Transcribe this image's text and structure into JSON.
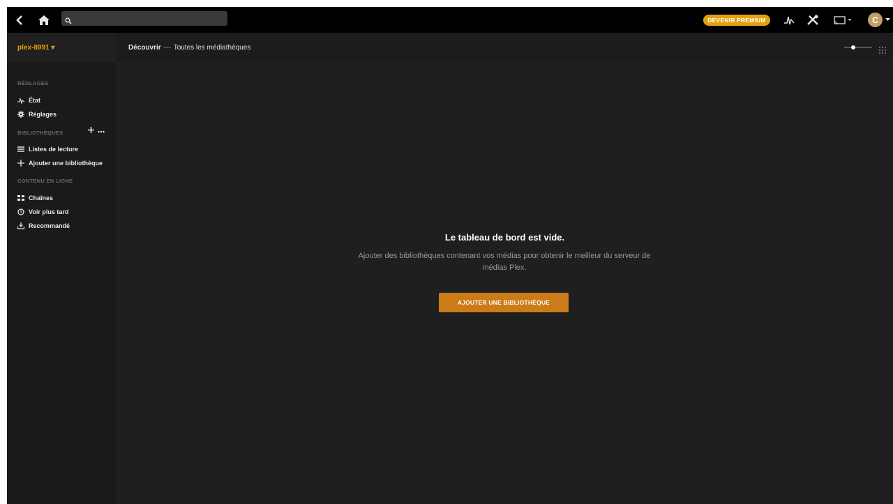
{
  "topbar": {
    "back_icon": "chevron-left-icon",
    "home_icon": "home-icon",
    "search": {
      "value": "",
      "placeholder": ""
    },
    "premium_label": "DEVENIR PREMIUM",
    "activity_icon": "activity-icon",
    "settings_icon": "wrench-tools-icon",
    "cast_icon": "cast-icon",
    "avatar_letter": "C"
  },
  "sidebar": {
    "server_name": "plex-8991 ▾",
    "sections": {
      "settings_head": "RÉGLAGES",
      "libraries_head": "BIBLIOTHÈQUES",
      "online_head": "CONTENU EN LIGNE"
    },
    "items": [
      {
        "label": "État",
        "icon": "activity-icon"
      },
      {
        "label": "Réglages",
        "icon": "gear-icon"
      },
      {
        "label": "Listes de lecture",
        "icon": "list-icon"
      },
      {
        "label": "Ajouter une bibliothèque",
        "icon": "plus-icon"
      },
      {
        "label": "Chaînes",
        "icon": "grid-icon"
      },
      {
        "label": "Voir plus tard",
        "icon": "clock-icon"
      },
      {
        "label": "Recommandé",
        "icon": "download-tray-icon"
      }
    ]
  },
  "main": {
    "breadcrumb": {
      "root": "Découvrir",
      "separator": "—",
      "current": "Toutes les médiathèques"
    },
    "empty": {
      "title": "Le tableau de bord est vide.",
      "description": "Ajouter des bibliothèques contenant vos médias pour obtenir le meilleur du serveur de médias Plex.",
      "button": "AJOUTER UNE BIBLIOTHÈQUE"
    }
  },
  "colors": {
    "accent": "#e5a00d",
    "button": "#cc7b19",
    "background": "#1f1f1f",
    "topbar": "#000000"
  }
}
